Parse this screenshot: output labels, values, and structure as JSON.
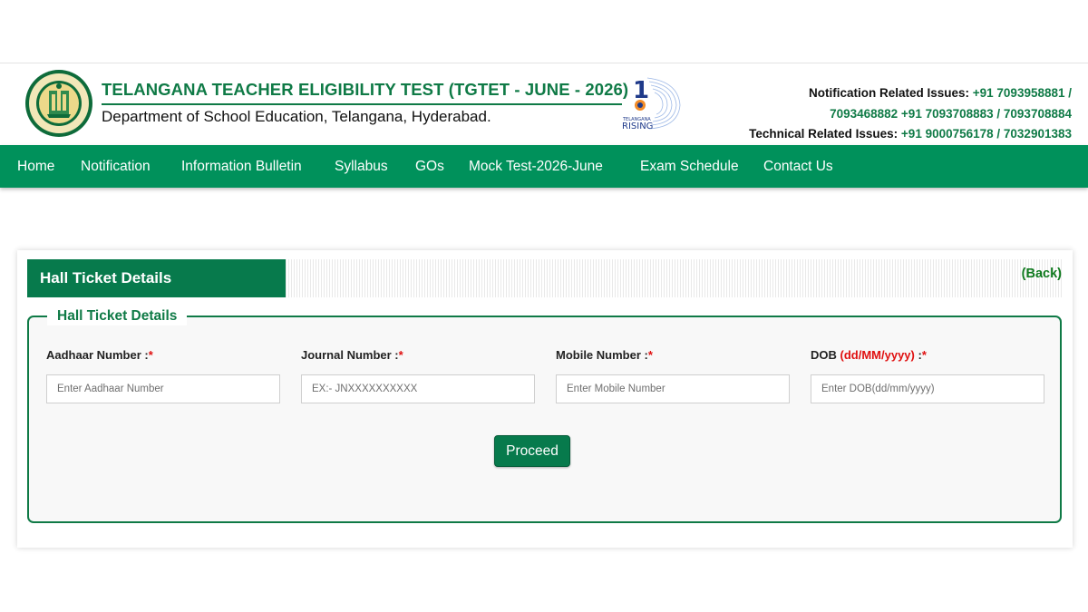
{
  "header": {
    "title": "TELANGANA TEACHER ELIGIBILITY TEST (TGTET - JUNE - 2026)",
    "subtitle": "Department of School Education, Telangana, Hyderabad.",
    "emblem_icon": "telangana-emblem-icon",
    "rising_logo": {
      "icon": "telangana-rising-logo",
      "line1": "TELANGANA",
      "line2": "RISING"
    },
    "contacts": {
      "notification_label": "Notification Related Issues:",
      "notification_line1": "+91 7093958881 /",
      "notification_line2": "7093468882 +91 7093708883 / 7093708884",
      "technical_label": "Technical Related Issues:",
      "technical_numbers": "+91 9000756178 / 7032901383"
    }
  },
  "nav": {
    "items": [
      {
        "label": "Home"
      },
      {
        "label": "Notification"
      },
      {
        "label": "Information Bulletin"
      },
      {
        "label": "Syllabus"
      },
      {
        "label": "GOs"
      },
      {
        "label": "Mock Test-2026-June"
      },
      {
        "label": "Exam Schedule"
      },
      {
        "label": "Contact Us"
      }
    ]
  },
  "card": {
    "heading": "Hall Ticket Details",
    "back_label": "(Back)",
    "legend": "Hall Ticket Details",
    "fields": [
      {
        "label": "Aadhaar Number :",
        "required": "*",
        "placeholder": "Enter Aadhaar Number",
        "value": ""
      },
      {
        "label": "Journal Number :",
        "required": "*",
        "placeholder": "EX:- JNXXXXXXXXXX",
        "value": ""
      },
      {
        "label": "Mobile Number :",
        "required": "*",
        "placeholder": "Enter Mobile Number",
        "value": ""
      },
      {
        "label": "DOB",
        "format": "(dd/MM/yyyy)",
        "label_suffix": " :",
        "required": "*",
        "placeholder": "Enter DOB(dd/mm/yyyy)",
        "value": ""
      }
    ],
    "submit_label": "Proceed"
  },
  "colors": {
    "brand_green": "#0f7a46",
    "nav_green": "#00915b",
    "button_green": "#077a4c",
    "required_red": "#e01010"
  }
}
